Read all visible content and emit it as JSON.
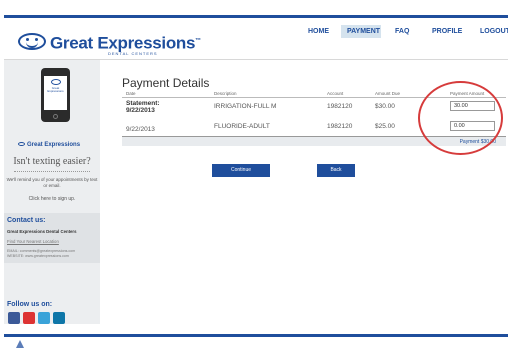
{
  "brand": {
    "name": "Great Expressions",
    "trademark": "™",
    "subtitle": "DENTAL CENTERS"
  },
  "nav": {
    "home": "HOME",
    "payment": "PAYMENT",
    "faq": "FAQ",
    "profile": "PROFILE",
    "logout": "LOGOUT",
    "active": "payment"
  },
  "sidebar": {
    "phone_logo_text": "Great Expressions",
    "heading": "Isn't texting easier?",
    "copy": "We'll remind you of your appointments by text or email.",
    "signup": "Click here to sign up.",
    "contact": {
      "heading": "Contact us:",
      "org": "Great Expressions Dental Centers",
      "locator": "Find Your Nearest Location",
      "email": "EMAIL: comments@greatexpressions.com",
      "website": "WEBSITE: www.greatexpressions.com"
    },
    "follow": "Follow us on:",
    "social_icons": [
      "facebook-icon",
      "youtube-icon",
      "twitter-icon",
      "linkedin-icon"
    ]
  },
  "payment": {
    "title": "Payment Details",
    "columns": {
      "date": "Date",
      "description": "Description",
      "account": "Account",
      "amount_due": "Amount Due",
      "payment_amount": "Payment Amount"
    },
    "rows": [
      {
        "date_statement": "Statement: 9/22/2013",
        "date": "9/22/2013",
        "description": "IRRIGATION-FULL M",
        "account": "1982120",
        "amount_due": "$30.00",
        "payment_amount": "30.00"
      },
      {
        "date": "9/22/2013",
        "description": "FLUORIDE-ADULT",
        "account": "1982120",
        "amount_due": "$25.00",
        "payment_amount": "0.00"
      }
    ],
    "total": "Payment $30.00",
    "continue_label": "Continue",
    "back_label": "Back"
  },
  "colors": {
    "brand_blue": "#1f4e9c",
    "highlight_circle": "#d63b3b",
    "active_tab": "#d5e3ee"
  }
}
